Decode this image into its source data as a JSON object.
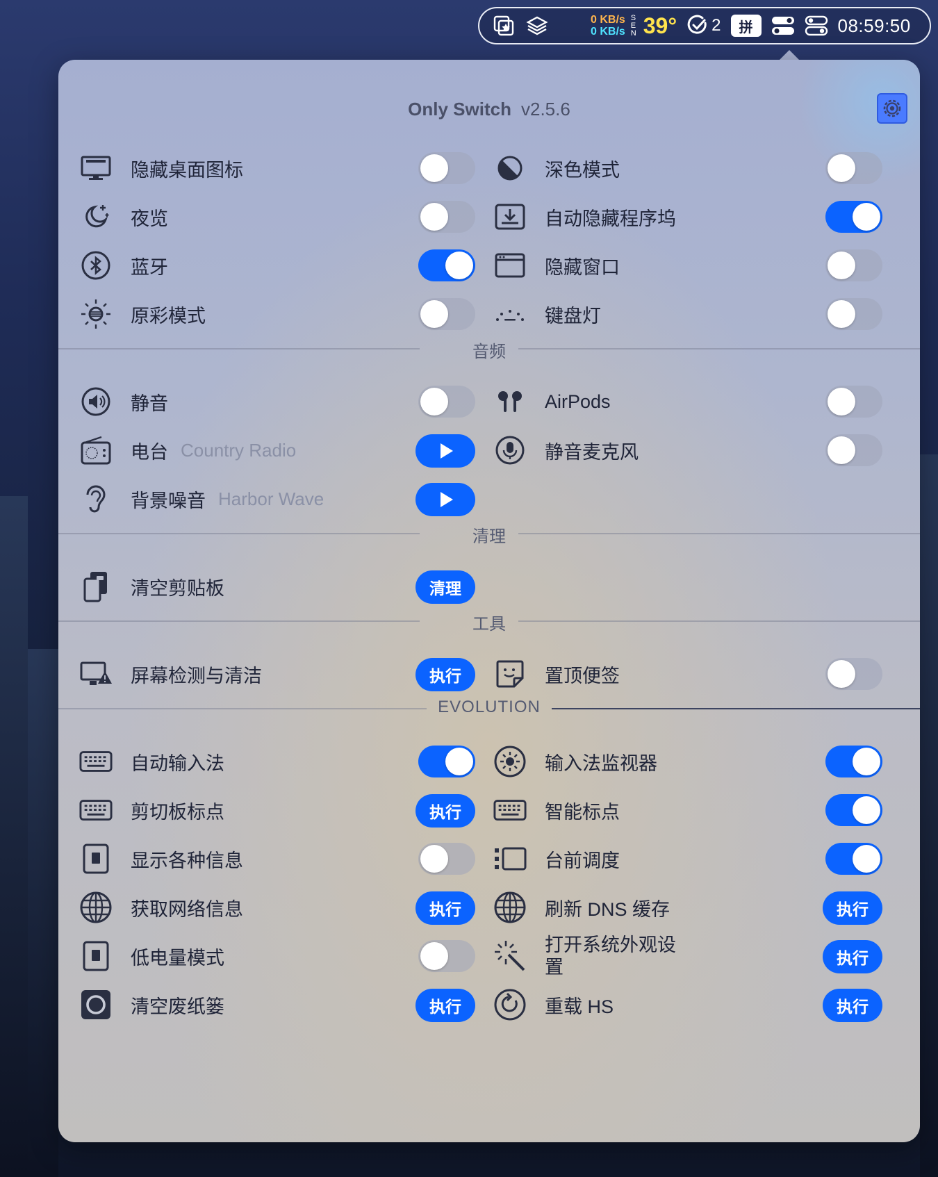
{
  "menubar": {
    "net_up": "0 KB/s",
    "net_down": "0 KB/s",
    "sen": [
      "S",
      "E",
      "N"
    ],
    "temperature": "39°",
    "tasks_count": "2",
    "ime": "拼",
    "clock": "08:59:50"
  },
  "panel": {
    "title": "Only Switch",
    "version": "v2.5.6"
  },
  "sections": {
    "audio": "音频",
    "clean": "清理",
    "tools": "工具",
    "evolution": "EVOLUTION"
  },
  "switches": {
    "hide_desktop_icons": {
      "label": "隐藏桌面图标",
      "on": false
    },
    "dark_mode": {
      "label": "深色模式",
      "on": false
    },
    "night_shift": {
      "label": "夜览",
      "on": false
    },
    "auto_hide_dock": {
      "label": "自动隐藏程序坞",
      "on": true
    },
    "bluetooth": {
      "label": "蓝牙",
      "on": true
    },
    "hide_windows": {
      "label": "隐藏窗口",
      "on": false
    },
    "true_tone": {
      "label": "原彩模式",
      "on": false
    },
    "keyboard_light": {
      "label": "键盘灯",
      "on": false
    },
    "mute": {
      "label": "静音",
      "on": false
    },
    "airpods": {
      "label": "AirPods",
      "on": false
    },
    "radio": {
      "label": "电台",
      "sub": "Country Radio"
    },
    "mute_mic": {
      "label": "静音麦克风",
      "on": false
    },
    "background_noise": {
      "label": "背景噪音",
      "sub": "Harbor Wave"
    },
    "clear_clipboard": {
      "label": "清空剪贴板",
      "action": "清理"
    },
    "screen_test": {
      "label": "屏幕检测与清洁",
      "action": "执行"
    },
    "sticky_note": {
      "label": "置顶便签",
      "on": false
    },
    "auto_ime": {
      "label": "自动输入法",
      "on": true
    },
    "ime_monitor": {
      "label": "输入法监视器",
      "on": true
    },
    "clipboard_punct": {
      "label": "剪切板标点",
      "action": "执行"
    },
    "smart_punct": {
      "label": "智能标点",
      "on": true
    },
    "show_info": {
      "label": "显示各种信息",
      "on": false
    },
    "stage_manager": {
      "label": "台前调度",
      "on": true
    },
    "network_info": {
      "label": "获取网络信息",
      "action": "执行"
    },
    "flush_dns": {
      "label": "刷新 DNS 缓存",
      "action": "执行"
    },
    "low_power": {
      "label": "低电量模式",
      "on": false
    },
    "appearance": {
      "label": "打开系统外观设置",
      "action": "执行"
    },
    "empty_trash": {
      "label": "清空废纸篓",
      "action": "执行"
    },
    "reload_hs": {
      "label": "重载 HS",
      "action": "执行"
    }
  },
  "colors": {
    "accent": "#0b63ff",
    "temp": "#ffe34d",
    "net_up": "#ffb54d",
    "net_down": "#4fe3ff"
  }
}
